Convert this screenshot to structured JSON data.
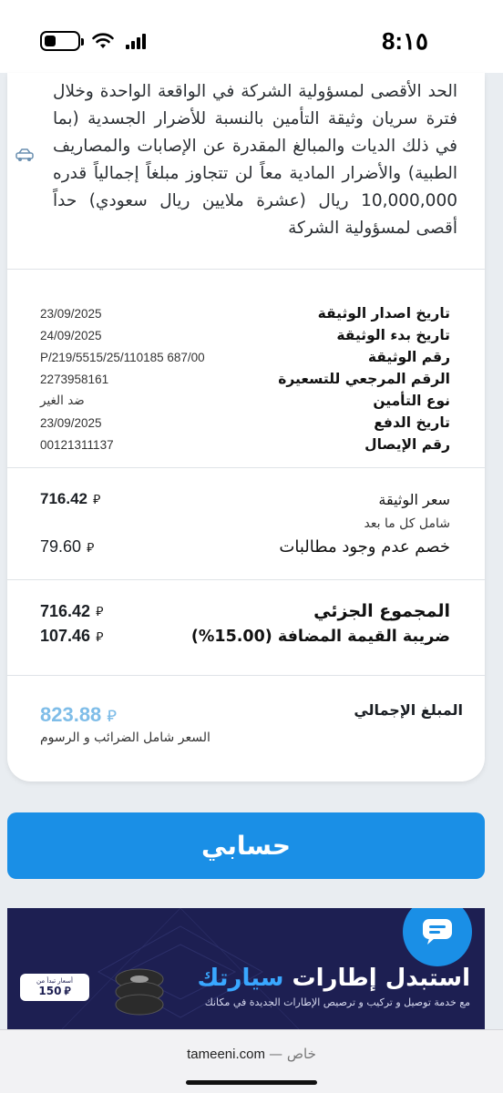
{
  "status_bar": {
    "time": "8:١٥"
  },
  "liability_text": "الحد الأقصى لمسؤولية الشركة في الواقعة الواحدة وخلال فترة سريان وثيقة التأمين بالنسبة للأضرار الجسدية (بما في ذلك الديات والمبالغ المقدرة عن الإصابات والمصاريف الطبية) والأضرار المادية معاً لن تتجاوز مبلغاً إجمالياً قدره 10,000,000 ريال (عشرة ملايين ريال سعودي) حداً أقصى لمسؤولية الشركة",
  "policy_info": [
    {
      "label": "تاريخ اصدار الوثيقة",
      "value": "23/09/2025"
    },
    {
      "label": "تاريخ بدء الوثيقة",
      "value": "24/09/2025"
    },
    {
      "label": "رقم الوثيقة",
      "value": "P/219/5515/25/110185 687/00"
    },
    {
      "label": "الرقم المرجعي للتسعيرة",
      "value": "2273958161"
    },
    {
      "label": "نوع التأمين",
      "value": "ضد الغير"
    },
    {
      "label": "تاريخ الدفع",
      "value": "23/09/2025"
    },
    {
      "label": "رقم الإيصال",
      "value": "00121311137"
    }
  ],
  "pricing": {
    "currency_symbol": "⃁",
    "policy_price_label": "سعر الوثيقة",
    "policy_price_value": "716.42",
    "includes_note": "شامل كل ما بعد",
    "no_claims_label": "خصم عدم وجود مطالبات",
    "no_claims_value": "79.60",
    "subtotal_label": "المجموع الجزئي",
    "subtotal_value": "716.42",
    "vat_label": "ضريبة القيمة المضافة (15.00%)",
    "vat_value": "107.46",
    "total_label": "المبلغ الإجمالي",
    "total_value": "823.88",
    "total_note": "السعر شامل الضرائب و الرسوم"
  },
  "main_button_label": "حسابي",
  "banner": {
    "title_prefix": "استبدل إطارات",
    "title_brand": "سيارتك",
    "subtitle": "مع خدمة توصيل و تركيب و ترصيص الإطارات الجديدة في مكانك",
    "badge_caption": "أسعار تبدأ من",
    "badge_price": "150"
  },
  "url_bar": {
    "domain": "tameeni.com",
    "private_label": "خاص"
  },
  "colors": {
    "primary": "#1a8fe6",
    "total": "#7fbde8",
    "banner_bg": "#1d1f52"
  }
}
